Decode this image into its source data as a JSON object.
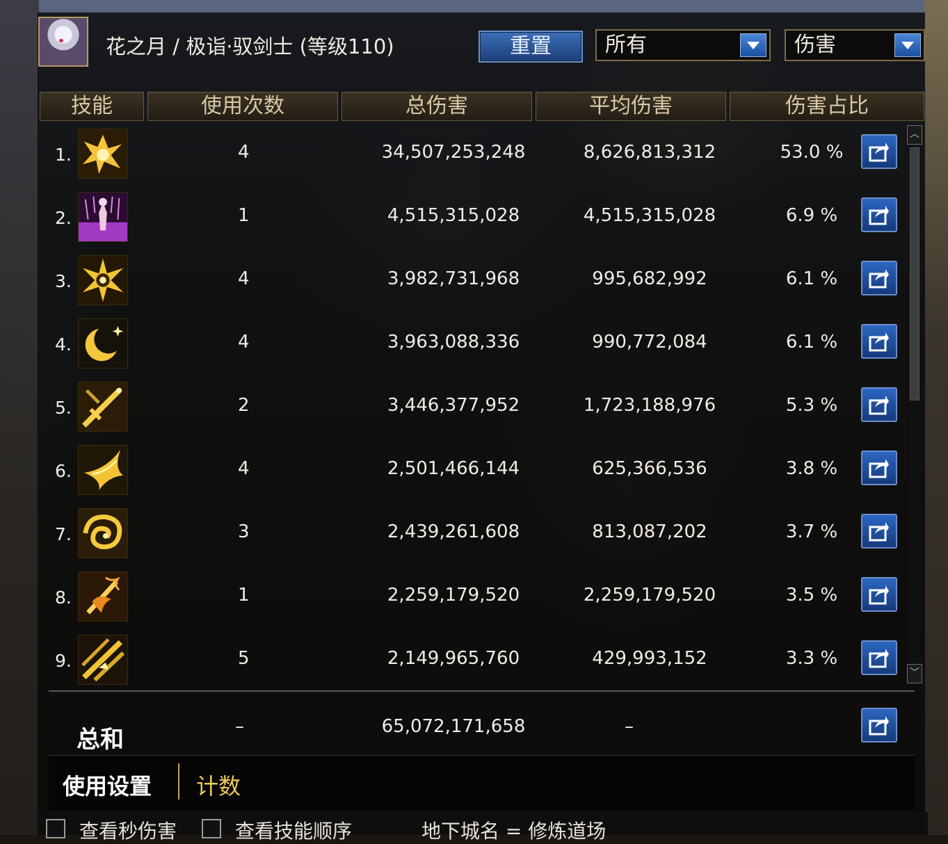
{
  "header": {
    "character_title": "花之月 / 极诣·驭剑士 (等级110)",
    "reset_label": "重置",
    "filter_value": "所有",
    "metric_value": "伤害"
  },
  "columns": [
    "技能",
    "使用次数",
    "总伤害",
    "平均伤害",
    "伤害占比"
  ],
  "skills": [
    {
      "rank": "1.",
      "icon": "golden-burst-icon",
      "uses": "4",
      "total": "34,507,253,248",
      "avg": "8,626,813,312",
      "share": "53.0 %"
    },
    {
      "rank": "2.",
      "icon": "purple-summon-icon",
      "uses": "1",
      "total": "4,515,315,028",
      "avg": "4,515,315,028",
      "share": "6.9 %"
    },
    {
      "rank": "3.",
      "icon": "radiant-sword-star-icon",
      "uses": "4",
      "total": "3,982,731,968",
      "avg": "995,682,992",
      "share": "6.1 %"
    },
    {
      "rank": "4.",
      "icon": "crescent-moon-icon",
      "uses": "4",
      "total": "3,963,088,336",
      "avg": "990,772,084",
      "share": "6.1 %"
    },
    {
      "rank": "5.",
      "icon": "crossed-swords-icon",
      "uses": "2",
      "total": "3,446,377,952",
      "avg": "1,723,188,976",
      "share": "5.3 %"
    },
    {
      "rank": "6.",
      "icon": "wing-slash-icon",
      "uses": "4",
      "total": "2,501,466,144",
      "avg": "625,366,536",
      "share": "3.8 %"
    },
    {
      "rank": "7.",
      "icon": "golden-swirl-icon",
      "uses": "3",
      "total": "2,439,261,608",
      "avg": "813,087,202",
      "share": "3.7 %"
    },
    {
      "rank": "8.",
      "icon": "flame-sword-icon",
      "uses": "1",
      "total": "2,259,179,520",
      "avg": "2,259,179,520",
      "share": "3.5 %"
    },
    {
      "rank": "9.",
      "icon": "triple-slash-icon",
      "uses": "5",
      "total": "2,149,965,760",
      "avg": "429,993,152",
      "share": "3.3 %"
    }
  ],
  "total": {
    "label": "总和",
    "uses": "–",
    "damage": "65,072,171,658",
    "avg": "–"
  },
  "tabs": {
    "usage_settings": "使用设置",
    "count": "计数"
  },
  "bottom": {
    "check_second_damage": "查看秒伤害",
    "check_skill_order": "查看技能顺序",
    "dungeon": "地下城名 = 修炼道场"
  },
  "colors": {
    "accent_blue": "#2c66c0",
    "gold_header": "#d9c9a4",
    "active_tab": "#f0c85a"
  }
}
